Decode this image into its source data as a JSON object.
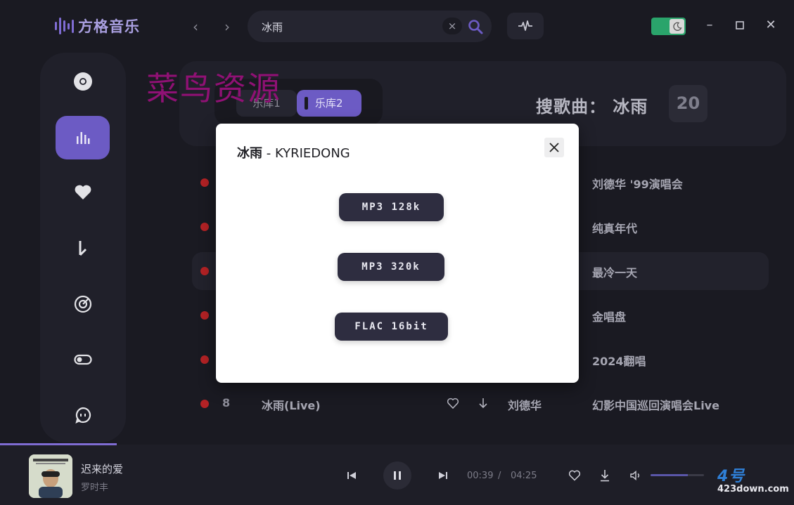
{
  "app": {
    "logo_text": "方格音乐"
  },
  "search": {
    "query": "冰雨",
    "clear_label": "×"
  },
  "library_tabs": [
    {
      "label": "乐库1"
    },
    {
      "label": "乐库2"
    }
  ],
  "results": {
    "title": "搜歌曲： 冰雨",
    "count": "20"
  },
  "watermark": "菜鸟资源",
  "songs": [
    {
      "num": "",
      "title": "",
      "artist": "",
      "album": "刘德华 '99演唱会"
    },
    {
      "num": "",
      "title": "",
      "artist": "",
      "album": "纯真年代"
    },
    {
      "num": "",
      "title": "",
      "artist": "",
      "album": "最冷一天"
    },
    {
      "num": "",
      "title": "",
      "artist": "",
      "album": "金唱盘"
    },
    {
      "num": "",
      "title": "",
      "artist": "",
      "album": "2024翻唱"
    },
    {
      "num": "8",
      "title": "冰雨(Live)",
      "artist": "刘德华",
      "album": "幻影中国巡回演唱会Live"
    }
  ],
  "player": {
    "title": "迟来的爱",
    "artist": "罗时丰",
    "current_time": "00:39",
    "separator": "/",
    "total_time": "04:25",
    "progress": 0.147,
    "volume": 0.7
  },
  "site_watermark": {
    "big": "4号",
    "small": "423down.com"
  },
  "modal": {
    "song": "冰雨",
    "separator": " - ",
    "artist": "KYRIEDONG",
    "options": [
      "MP3 128k",
      "MP3 320k",
      "FLAC 16bit"
    ]
  },
  "colors": {
    "accent": "#6c5bc4",
    "dot": "#b32225",
    "toggle": "#2aa46b"
  }
}
